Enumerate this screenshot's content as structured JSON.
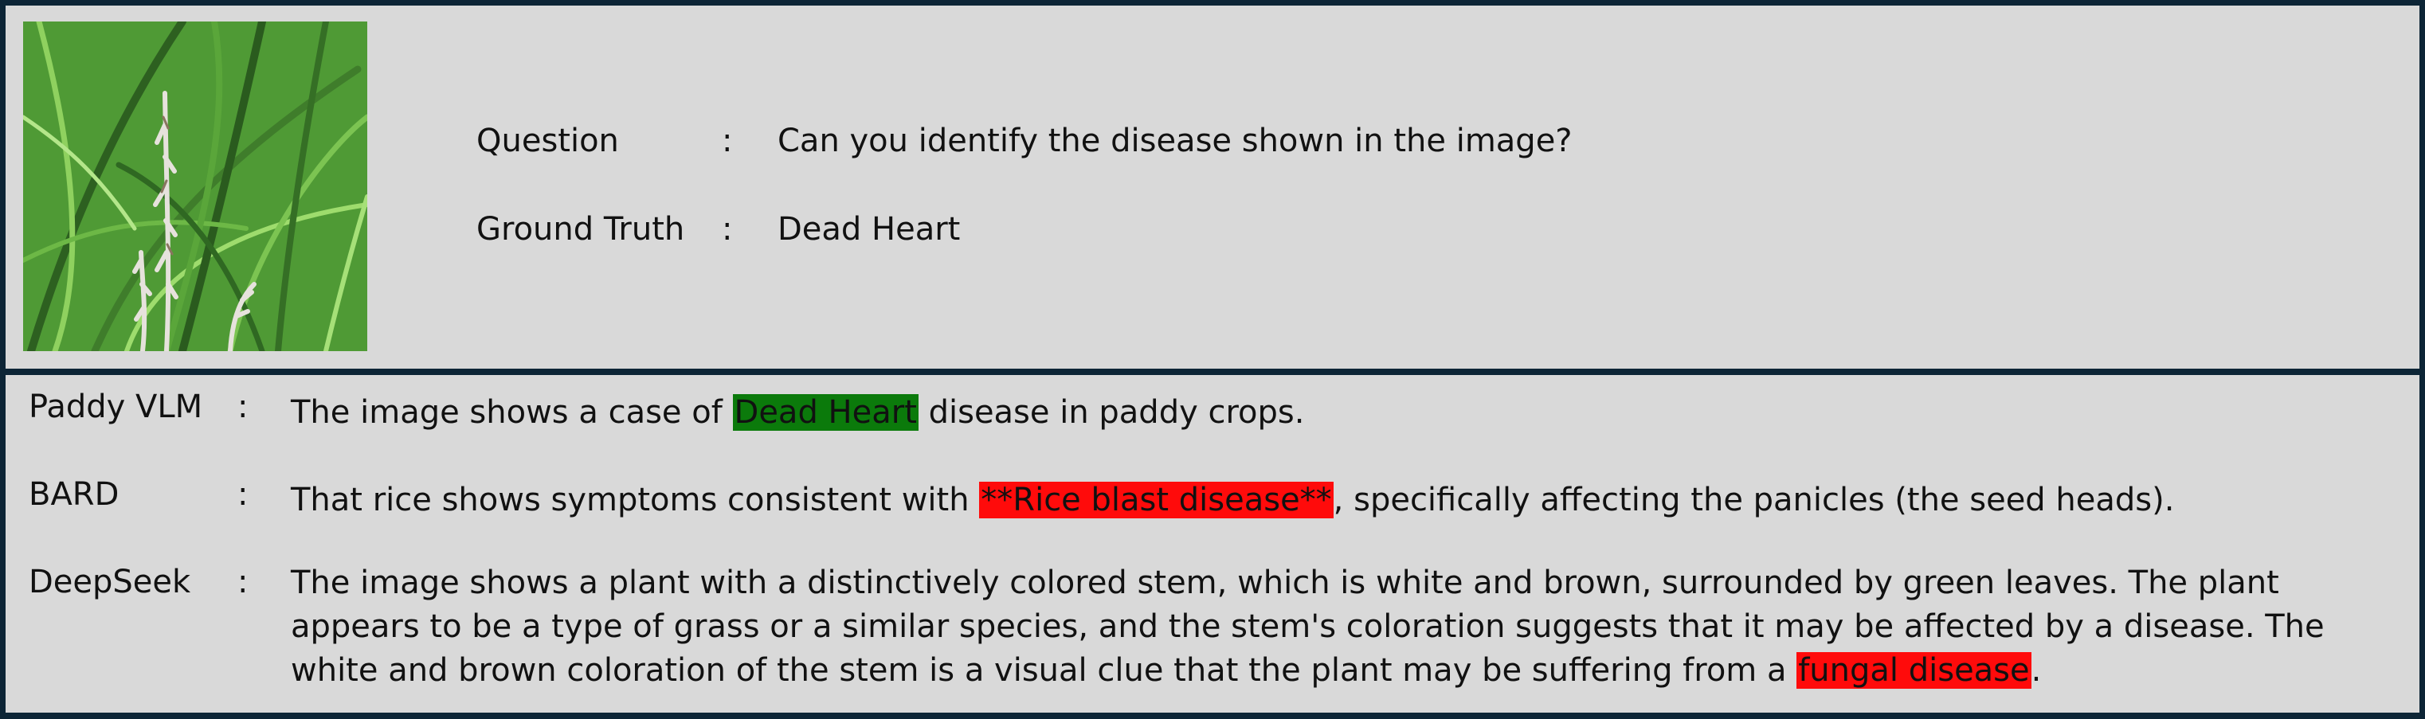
{
  "question": {
    "label": "Question",
    "colon": ":",
    "text": "Can you identify the disease shown in the image?"
  },
  "ground_truth": {
    "label": "Ground Truth",
    "colon": ":",
    "text": "Dead Heart"
  },
  "responses": [
    {
      "model": "Paddy VLM",
      "colon": ":",
      "before": "The image shows a case of",
      "highlight": "Dead Heart",
      "after": "disease in paddy crops.",
      "highlight_color": "#0b7a0b"
    },
    {
      "model": "BARD",
      "colon": ":",
      "before": "That rice shows symptoms consistent with",
      "highlight": "**Rice blast disease**",
      "after": ", specifically affecting the panicles (the seed heads).",
      "highlight_color": "#ff0b0b"
    },
    {
      "model": "DeepSeek",
      "colon": ":",
      "before": "The image shows a plant with a distinctively colored stem, which is white and brown, surrounded by green leaves. The plant appears to be a type of grass or a similar species, and the stem's coloration suggests that it may be affected by a disease. The white and brown coloration of the stem is a visual clue that the plant may be suffering from a",
      "highlight": "fungal disease",
      "after": ".",
      "highlight_color": "#ff0b0b"
    }
  ],
  "image": {
    "subject": "rice plant with white panicles among green leaves"
  }
}
